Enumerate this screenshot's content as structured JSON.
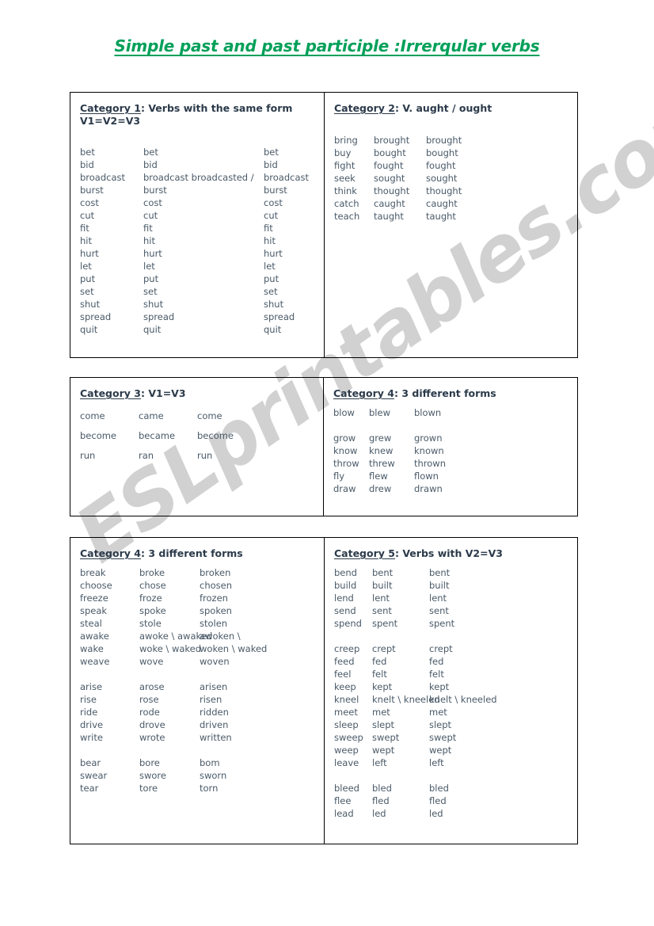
{
  "document": {
    "title": "Simple past and past participle :Irrerqular verbs",
    "title_color": "#00a05a",
    "body_text_color": "#4a5a68",
    "heading_color": "#2b3a4a",
    "watermark": "ESLprintables.com",
    "watermark_color": "#c9c9c9"
  },
  "boxes": [
    {
      "id": "category-1",
      "heading_label": "Category 1",
      "heading_rest": ": Verbs with the same form",
      "heading_sub": "V1=V2=V3",
      "rows": [
        [
          "bet",
          "bet",
          "bet"
        ],
        [
          "bid",
          "bid",
          "bid"
        ],
        [
          "broadcast",
          "broadcast broadcasted /",
          "broadcast"
        ],
        [
          "burst",
          " burst",
          "burst"
        ],
        [
          "cost",
          "cost",
          "cost"
        ],
        [
          "cut",
          "cut",
          "cut"
        ],
        [
          "fit",
          "fit",
          "fit"
        ],
        [
          "hit",
          "hit",
          "hit"
        ],
        [
          "hurt",
          "hurt",
          "hurt"
        ],
        [
          "let",
          " let",
          "let"
        ],
        [
          "put",
          "put",
          " put"
        ],
        [
          "set",
          "set",
          " set"
        ],
        [
          "shut",
          "shut",
          " shut"
        ],
        [
          "spread",
          " spread",
          "spread"
        ],
        [
          "quit",
          "quit",
          "quit"
        ]
      ]
    },
    {
      "id": "category-2",
      "heading_label": "Category 2",
      "heading_rest": ": V. aught / ought",
      "heading_sub": "",
      "rows": [
        [
          "bring",
          "brought",
          " brought"
        ],
        [
          "buy",
          "bought",
          "bought"
        ],
        [
          "fight",
          "fought",
          "fought"
        ],
        [
          "seek",
          "sought",
          "sought"
        ],
        [
          "think",
          "thought",
          "thought"
        ],
        [
          "catch",
          " caught",
          "caught"
        ],
        [
          "teach",
          " taught",
          "taught"
        ]
      ]
    },
    {
      "id": "category-3",
      "heading_label": "Category 3",
      "heading_rest": ": V1=V3",
      "heading_sub": "",
      "rows": [
        [
          "come",
          "came",
          "come"
        ],
        [
          "become",
          "became",
          "become"
        ],
        [
          "run",
          "ran",
          "run"
        ]
      ]
    },
    {
      "id": "category-4-top",
      "heading_label": "Category 4",
      "heading_rest": ": 3 different forms",
      "heading_sub": "",
      "rows": [
        [
          "blow",
          "blew",
          "blown"
        ],
        [
          "",
          "",
          ""
        ],
        [
          "grow",
          "grew",
          "grown"
        ],
        [
          "know",
          "knew",
          " known"
        ],
        [
          "throw",
          "threw",
          "thrown"
        ],
        [
          "fly",
          " flew",
          " flown"
        ],
        [
          "draw",
          " drew",
          "drawn"
        ]
      ]
    },
    {
      "id": "category-4-bottom",
      "heading_label": "Category 4",
      "heading_rest": ": 3 different forms",
      "heading_sub": "",
      "rows": [
        [
          "break",
          "broke",
          "broken"
        ],
        [
          "choose",
          "chose",
          " chosen"
        ],
        [
          "freeze",
          "froze",
          " frozen"
        ],
        [
          "speak",
          "spoke",
          " spoken"
        ],
        [
          "steal",
          "stole",
          "stolen"
        ],
        [
          "awake",
          "awoke \\ awaked",
          "   awoken \\"
        ],
        [
          "wake",
          "woke \\ waked",
          " woken \\ waked"
        ],
        [
          "weave",
          "wove",
          " woven"
        ],
        [
          "",
          "",
          ""
        ],
        [
          "arise",
          " arose",
          " arisen"
        ],
        [
          "rise",
          "rose",
          "risen"
        ],
        [
          "ride",
          "rode",
          " ridden"
        ],
        [
          "drive",
          "drove",
          " driven"
        ],
        [
          "write",
          "wrote",
          " written"
        ],
        [
          "",
          "",
          ""
        ],
        [
          "bear",
          "bore",
          "bom"
        ],
        [
          "swear",
          "swore",
          " sworn"
        ],
        [
          "tear",
          "tore",
          "torn"
        ]
      ]
    },
    {
      "id": "category-5",
      "heading_label": "Category 5",
      "heading_rest": ": Verbs with V2=V3",
      "heading_sub": "",
      "rows": [
        [
          "bend",
          "bent",
          "bent"
        ],
        [
          "build",
          "built",
          "built"
        ],
        [
          "lend",
          "lent",
          "lent"
        ],
        [
          "send",
          "sent",
          "sent"
        ],
        [
          "spend",
          "spent",
          "spent"
        ],
        [
          "",
          "",
          ""
        ],
        [
          "creep",
          "crept",
          " crept"
        ],
        [
          "feed",
          "fed",
          "fed"
        ],
        [
          "feel",
          "felt",
          "felt"
        ],
        [
          "keep",
          "kept",
          " kept"
        ],
        [
          "kneel",
          "knelt \\ kneeled",
          "  knelt \\ kneeled"
        ],
        [
          "meet",
          "met",
          "  met"
        ],
        [
          "sleep",
          " slept",
          "slept"
        ],
        [
          "sweep",
          "swept",
          " swept"
        ],
        [
          "weep",
          "wept",
          "wept"
        ],
        [
          "leave",
          "left",
          "left"
        ],
        [
          "",
          "",
          ""
        ],
        [
          "bleed",
          "bled",
          " bled"
        ],
        [
          "flee",
          "fled",
          "fled"
        ],
        [
          "lead",
          "led",
          "led"
        ]
      ]
    }
  ]
}
